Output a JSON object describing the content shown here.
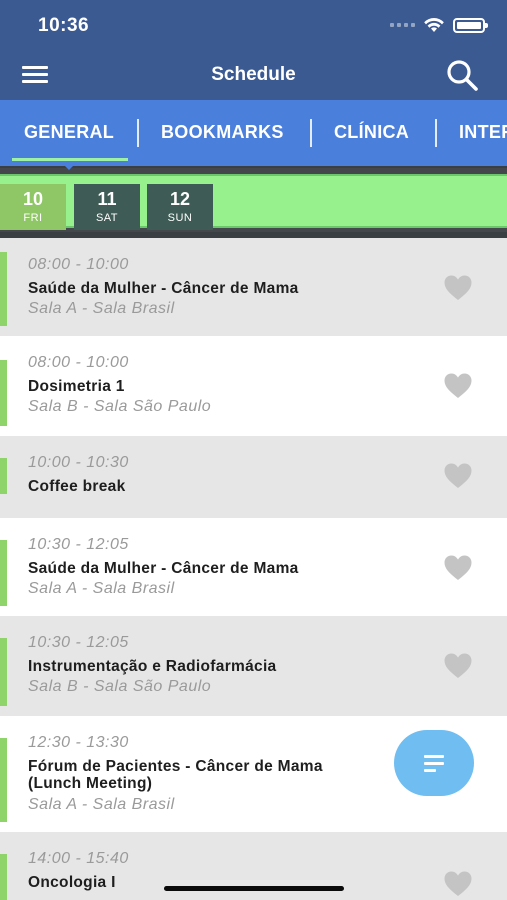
{
  "status_bar": {
    "time": "10:36"
  },
  "app_bar": {
    "title": "Schedule",
    "menu_icon": "hamburger-menu-icon",
    "search_icon": "search-icon"
  },
  "tabs": [
    {
      "label": "GENERAL",
      "selected": true
    },
    {
      "label": "BOOKMARKS",
      "selected": false
    },
    {
      "label": "CLÍNICA",
      "selected": false
    },
    {
      "label": "INTER",
      "selected": false
    }
  ],
  "days": [
    {
      "num": "10",
      "dow": "FRI",
      "selected": true
    },
    {
      "num": "11",
      "dow": "SAT",
      "selected": false
    },
    {
      "num": "12",
      "dow": "SUN",
      "selected": false
    }
  ],
  "sessions": [
    {
      "time": "08:00 - 10:00",
      "title": "Saúde da Mulher - Câncer de Mama",
      "room": "Sala A - Sala Brasil"
    },
    {
      "time": "08:00 - 10:00",
      "title": "Dosimetria 1",
      "room": "Sala B - Sala São Paulo"
    },
    {
      "time": "10:00 - 10:30",
      "title": "Coffee break",
      "room": ""
    },
    {
      "time": "10:30 - 12:05",
      "title": "Saúde da Mulher - Câncer de Mama",
      "room": "Sala A - Sala Brasil"
    },
    {
      "time": "10:30 - 12:05",
      "title": "Instrumentação e Radiofarmácia",
      "room": "Sala B - Sala São Paulo"
    },
    {
      "time": "12:30 - 13:30",
      "title_line1": "Fórum de Pacientes - Câncer de Mama",
      "title_line2": "(Lunch Meeting)",
      "room": "Sala A - Sala Brasil"
    },
    {
      "time": "14:00 - 15:40",
      "title": "Oncologia I",
      "room": ""
    }
  ],
  "colors": {
    "app_bar": "#3c5a92",
    "tab_bar": "#4b7fdc",
    "date_strip": "#97f28e",
    "day_selected": "#8fc766",
    "day_unselected": "#3e5c55",
    "session_stripe": "#8fd46b",
    "fab": "#6fbdf1",
    "heart": "#c4c4c4"
  },
  "fab": {
    "icon": "list-filter-icon"
  }
}
